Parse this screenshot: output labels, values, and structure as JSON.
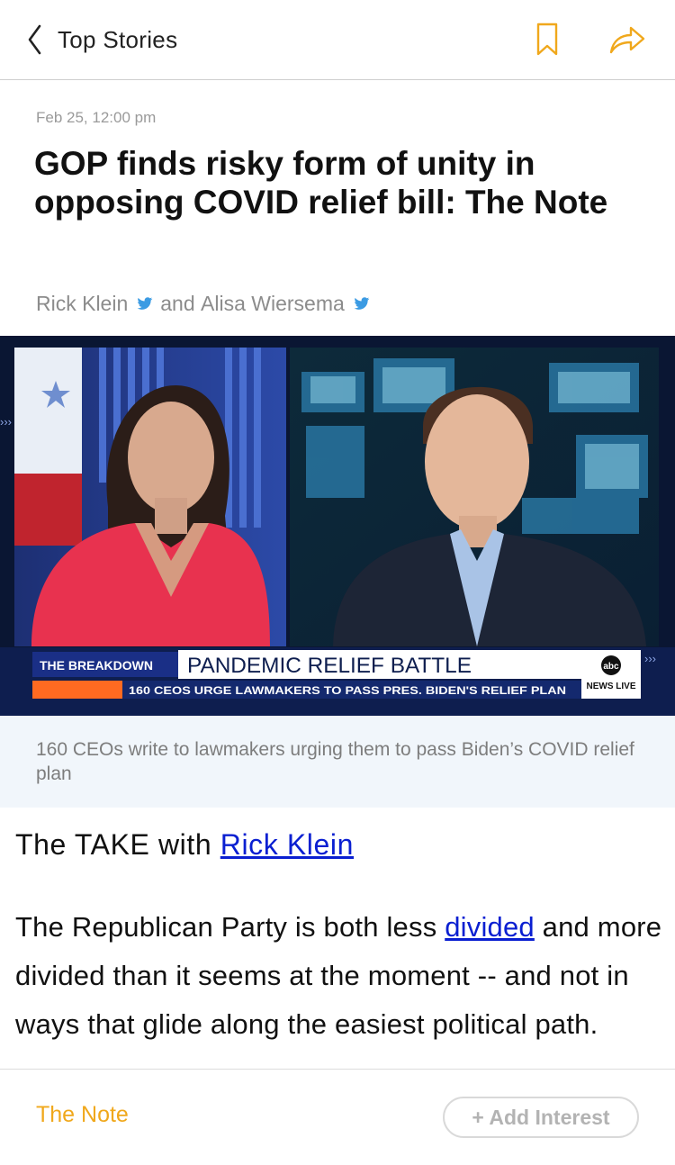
{
  "header": {
    "back_label": "Top Stories",
    "icons": {
      "back": "chevron-left-icon",
      "bookmark": "bookmark-icon",
      "share": "share-arrow-icon"
    },
    "accent_color": "#F0A81C"
  },
  "article": {
    "date": "Feb 25, 12:00 pm",
    "title": "GOP finds risky form of unity in opposing COVID relief bill: The Note",
    "authors": [
      {
        "name": "Rick Klein",
        "icon": "twitter-icon"
      },
      {
        "name": "Alisa Wiersema",
        "icon": "twitter-icon"
      }
    ],
    "byline_joiner": "and"
  },
  "media": {
    "lower_third_tag": "THE BREAKDOWN",
    "headline": "PANDEMIC RELIEF BATTLE",
    "ticker": "160 CEOS URGE LAWMAKERS TO PASS PRES. BIDEN'S RELIEF PLAN",
    "logo_text": "abc",
    "logo_sub": "NEWS LIVE",
    "arrows": "›››"
  },
  "caption": "160 CEOs write to lawmakers urging them to pass Biden’s COVID relief plan",
  "body": {
    "take_prefix": "The TAKE with ",
    "take_link": "Rick Klein",
    "para_before": "The Republican Party is both less ",
    "para_link": "divided",
    "para_after": " and more divided than it seems at the moment -- and not in ways that glide along the easiest political path."
  },
  "footer": {
    "topic": "The Note",
    "add_interest": "+ Add Interest",
    "topic_color": "#F0A81C"
  }
}
